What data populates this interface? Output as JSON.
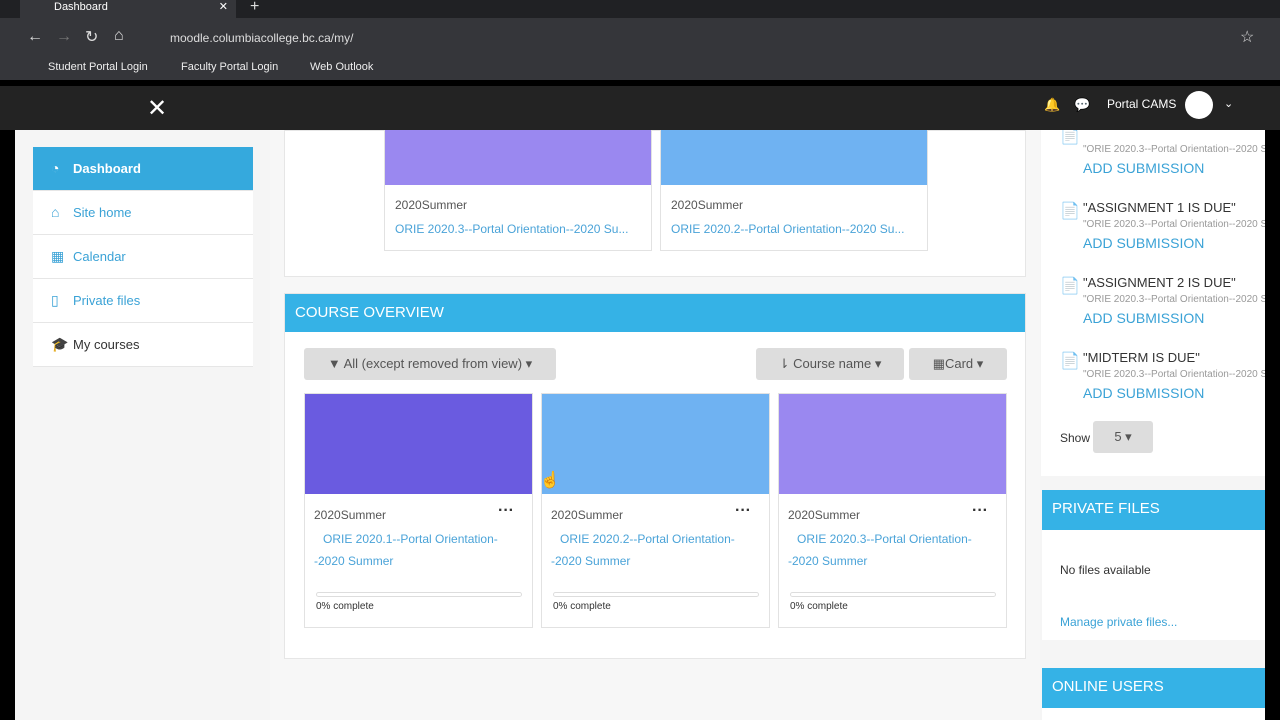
{
  "browser": {
    "tab_title": "Dashboard",
    "url": "moodle.columbiacollege.bc.ca/my/",
    "bookmarks": [
      "Student Portal Login",
      "Faculty Portal Login",
      "Web Outlook"
    ]
  },
  "navbar": {
    "user": "Portal CAMS"
  },
  "sidebar": {
    "items": [
      {
        "label": "Dashboard",
        "icon": "dashboard-icon"
      },
      {
        "label": "Site home",
        "icon": "home-icon"
      },
      {
        "label": "Calendar",
        "icon": "calendar-icon"
      },
      {
        "label": "Private files",
        "icon": "file-icon"
      },
      {
        "label": "My courses",
        "icon": "graduation-cap-icon"
      }
    ]
  },
  "recent": [
    {
      "category": "2020Summer",
      "name": "ORIE 2020.3--Portal Orientation--2020 Su..."
    },
    {
      "category": "2020Summer",
      "name": "ORIE 2020.2--Portal Orientation--2020 Su..."
    }
  ],
  "overview": {
    "title": "COURSE OVERVIEW",
    "filter": "All (except removed from view)",
    "sort": "Course name",
    "view": "Card",
    "courses": [
      {
        "category": "2020Summer",
        "name": "ORIE 2020.1--Portal Orientation--2020 Summer",
        "progress": "0% complete",
        "color": "#6a5be0"
      },
      {
        "category": "2020Summer",
        "name": "ORIE 2020.2--Portal Orientation--2020 Summer",
        "progress": "0% complete",
        "color": "#6fb2f2"
      },
      {
        "category": "2020Summer",
        "name": "ORIE 2020.3--Portal Orientation--2020 Summer",
        "progress": "0% complete",
        "color": "#9a88f0"
      }
    ]
  },
  "timeline": {
    "events": [
      {
        "title": "",
        "course": "\"ORIE 2020.3--Portal Orientation--2020 S",
        "action": "ADD SUBMISSION"
      },
      {
        "title": "\"ASSIGNMENT 1 IS DUE\"",
        "course": "\"ORIE 2020.3--Portal Orientation--2020 S",
        "action": "ADD SUBMISSION"
      },
      {
        "title": "\"ASSIGNMENT 2 IS DUE\"",
        "course": "\"ORIE 2020.3--Portal Orientation--2020 S",
        "action": "ADD SUBMISSION"
      },
      {
        "title": "\"MIDTERM IS DUE\"",
        "course": "\"ORIE 2020.3--Portal Orientation--2020 S",
        "action": "ADD SUBMISSION"
      }
    ],
    "show_label": "Show",
    "show_value": "5"
  },
  "private_files": {
    "title": "PRIVATE FILES",
    "empty": "No files available",
    "manage": "Manage private files..."
  },
  "online_users": {
    "title": "ONLINE USERS"
  }
}
